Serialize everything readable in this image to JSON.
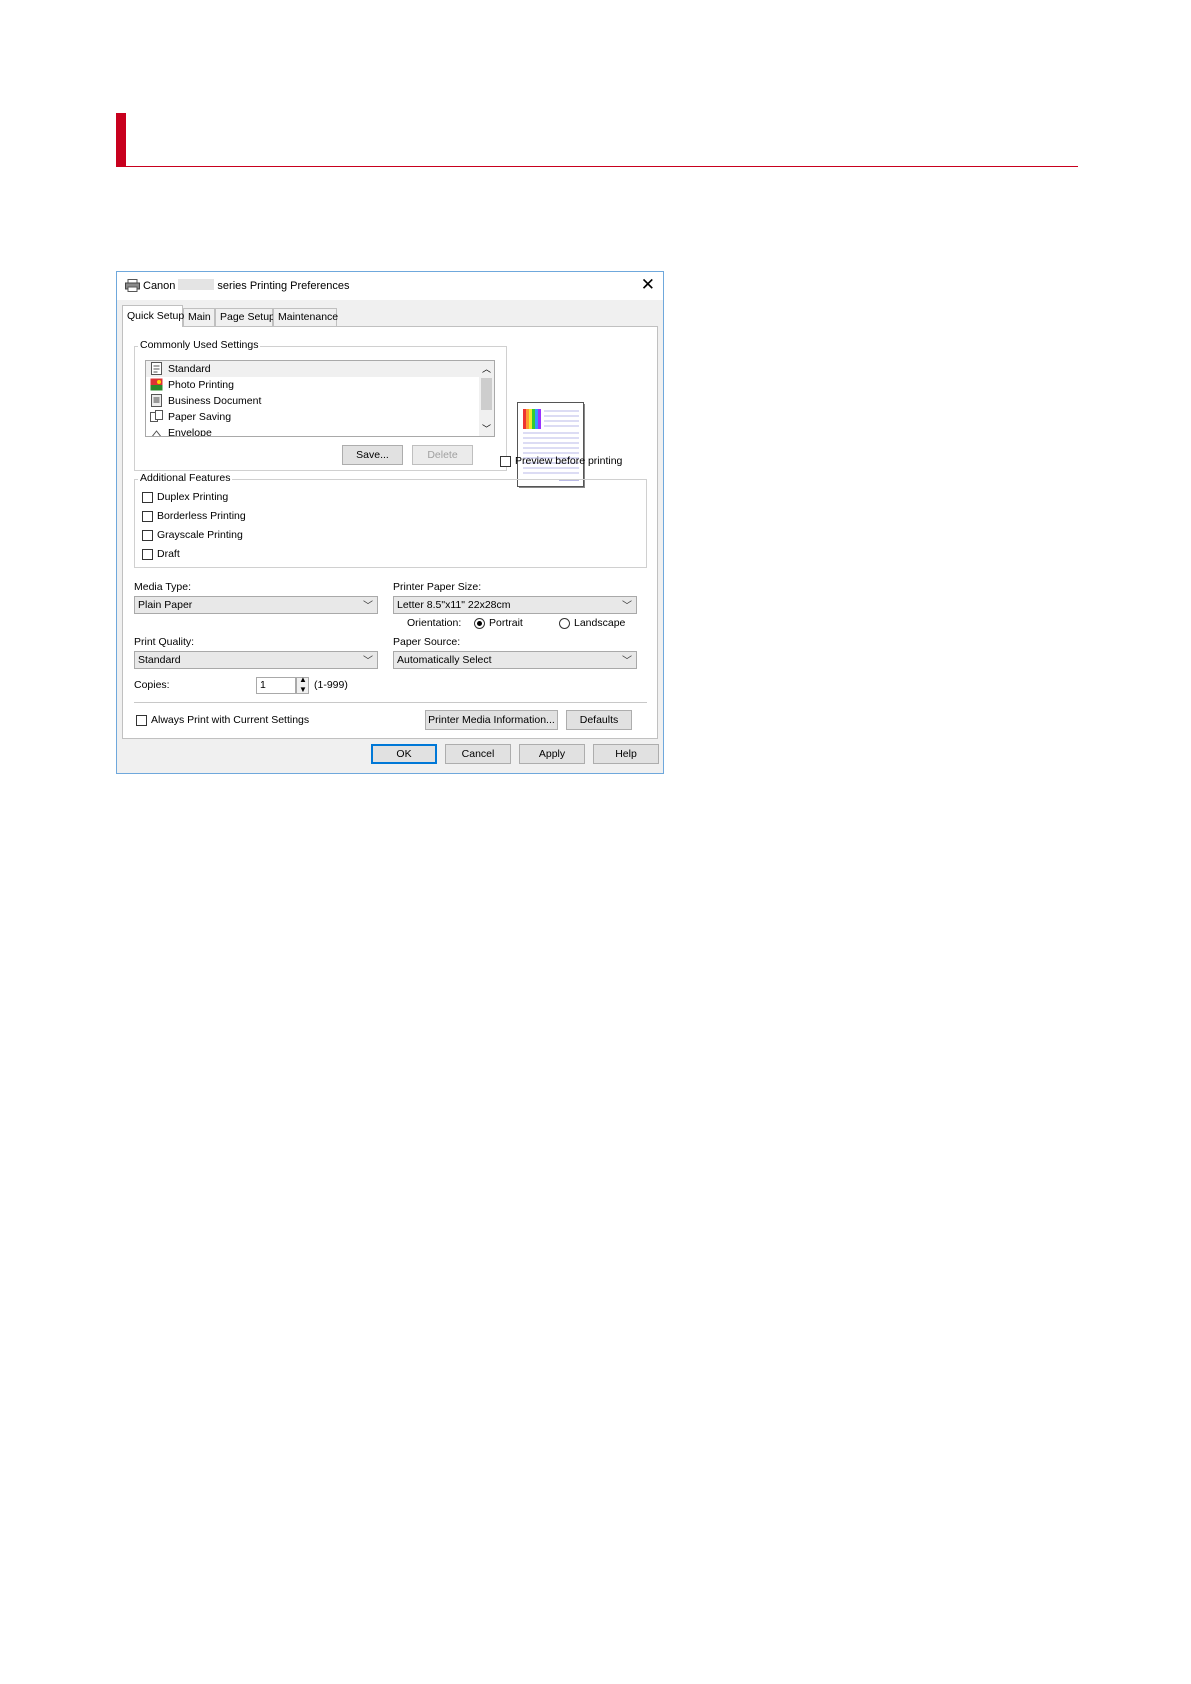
{
  "dialog": {
    "title_prefix": "Canon",
    "title_suffix": "series Printing Preferences",
    "close_glyph": "✕"
  },
  "tabs": [
    {
      "label": "Quick Setup",
      "active": true
    },
    {
      "label": "Main"
    },
    {
      "label": "Page Setup"
    },
    {
      "label": "Maintenance"
    }
  ],
  "common_settings": {
    "legend": "Commonly Used Settings",
    "items": [
      {
        "label": "Standard",
        "icon": "standard-doc-icon",
        "selected": true
      },
      {
        "label": "Photo Printing",
        "icon": "photo-icon"
      },
      {
        "label": "Business Document",
        "icon": "business-doc-icon"
      },
      {
        "label": "Paper Saving",
        "icon": "paper-saving-icon"
      },
      {
        "label": "Envelope",
        "icon": "envelope-icon"
      }
    ],
    "save_label": "Save...",
    "delete_label": "Delete"
  },
  "preview": {
    "label": "Preview before printing",
    "checked": false
  },
  "additional_features": {
    "legend": "Additional Features",
    "options": [
      {
        "label": "Duplex Printing",
        "checked": false
      },
      {
        "label": "Borderless Printing",
        "checked": false
      },
      {
        "label": "Grayscale Printing",
        "checked": false
      },
      {
        "label": "Draft",
        "checked": false
      }
    ]
  },
  "media_type": {
    "label": "Media Type:",
    "value": "Plain Paper"
  },
  "paper_size": {
    "label": "Printer Paper Size:",
    "value": "Letter 8.5\"x11\" 22x28cm"
  },
  "orientation": {
    "label": "Orientation:",
    "portrait": "Portrait",
    "landscape": "Landscape",
    "selected": "Portrait"
  },
  "print_quality": {
    "label": "Print Quality:",
    "value": "Standard"
  },
  "paper_source": {
    "label": "Paper Source:",
    "value": "Automatically Select"
  },
  "copies": {
    "label": "Copies:",
    "value": "1",
    "range": "(1-999)"
  },
  "always_print": {
    "label": "Always Print with Current Settings",
    "checked": false
  },
  "media_info_label": "Printer Media Information...",
  "defaults_label": "Defaults",
  "footer": {
    "ok": "OK",
    "cancel": "Cancel",
    "apply": "Apply",
    "help": "Help"
  },
  "colors": {
    "accent": "#c8001e",
    "focus": "#0078d7",
    "window_border": "#6fa8dc"
  }
}
